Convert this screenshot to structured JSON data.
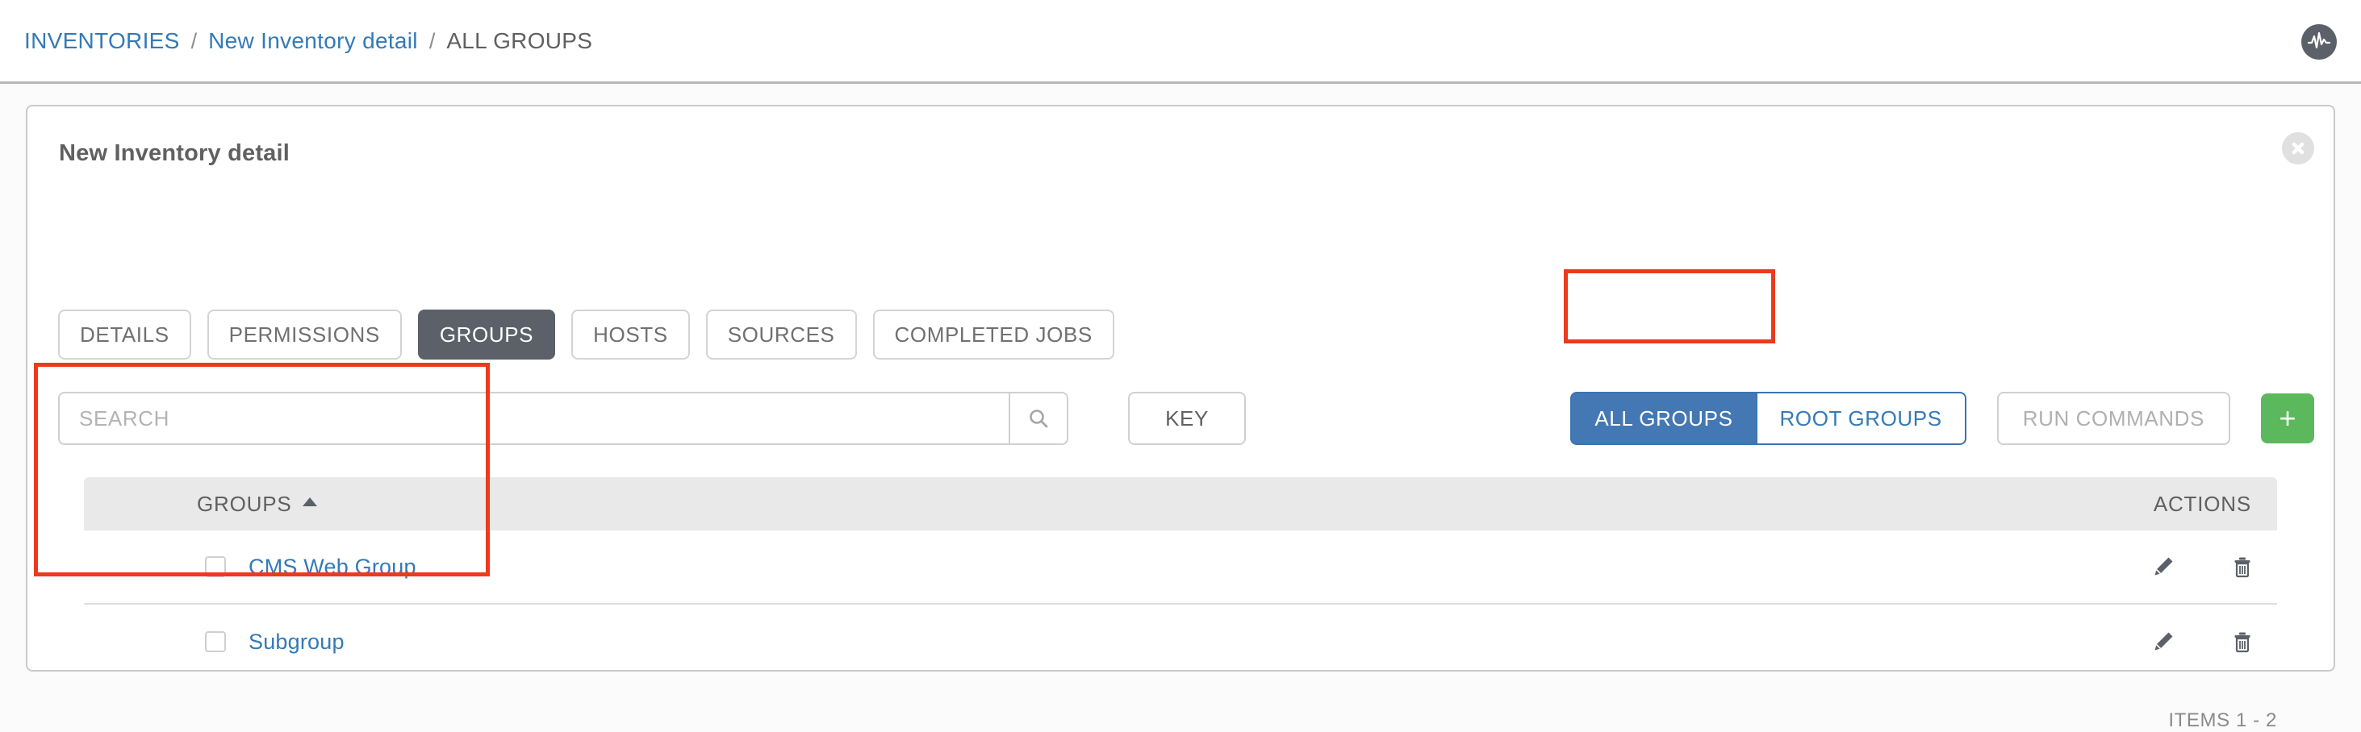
{
  "breadcrumb": {
    "items": [
      {
        "label": "INVENTORIES",
        "current": false
      },
      {
        "label": "New Inventory detail",
        "current": false
      },
      {
        "label": "ALL GROUPS",
        "current": true
      }
    ],
    "separator": "/"
  },
  "brand": {
    "logo_icon": "pulse-waveform-icon"
  },
  "card": {
    "title": "New Inventory detail",
    "close_icon": "close-circle-icon"
  },
  "tabs": [
    {
      "label": "DETAILS",
      "active": false
    },
    {
      "label": "PERMISSIONS",
      "active": false
    },
    {
      "label": "GROUPS",
      "active": true
    },
    {
      "label": "HOSTS",
      "active": false
    },
    {
      "label": "SOURCES",
      "active": false
    },
    {
      "label": "COMPLETED JOBS",
      "active": false
    }
  ],
  "toolbar": {
    "search": {
      "value": "",
      "placeholder": "SEARCH",
      "icon": "search-icon"
    },
    "key_label": "KEY",
    "all_groups_label": "ALL GROUPS",
    "root_groups_label": "ROOT GROUPS",
    "run_commands_label": "RUN COMMANDS",
    "add_label": "+",
    "add_icon": "plus-icon"
  },
  "table": {
    "columns": {
      "groups": "GROUPS",
      "actions": "ACTIONS"
    },
    "sort": {
      "column": "GROUPS",
      "direction": "asc",
      "icon": "caret-up-icon"
    },
    "rows": [
      {
        "name": "CMS Web Group",
        "checked": false,
        "edit_icon": "pencil-icon",
        "delete_icon": "trash-icon"
      },
      {
        "name": "Subgroup",
        "checked": false,
        "edit_icon": "pencil-icon",
        "delete_icon": "trash-icon"
      }
    ],
    "items_count": "ITEMS  1 - 2"
  },
  "colors": {
    "link": "#337ab7",
    "active_tab_bg": "#5b6069",
    "toggle_active_bg": "#4478b4",
    "add_button_bg": "#5cb85c",
    "annotation": "#ec3a1f",
    "header_row_bg": "#e9e9e9"
  },
  "annotations": [
    {
      "name": "all-groups-highlight",
      "target": "ALL GROUPS"
    },
    {
      "name": "groups-table-highlight",
      "target": "GROUPS table"
    }
  ]
}
